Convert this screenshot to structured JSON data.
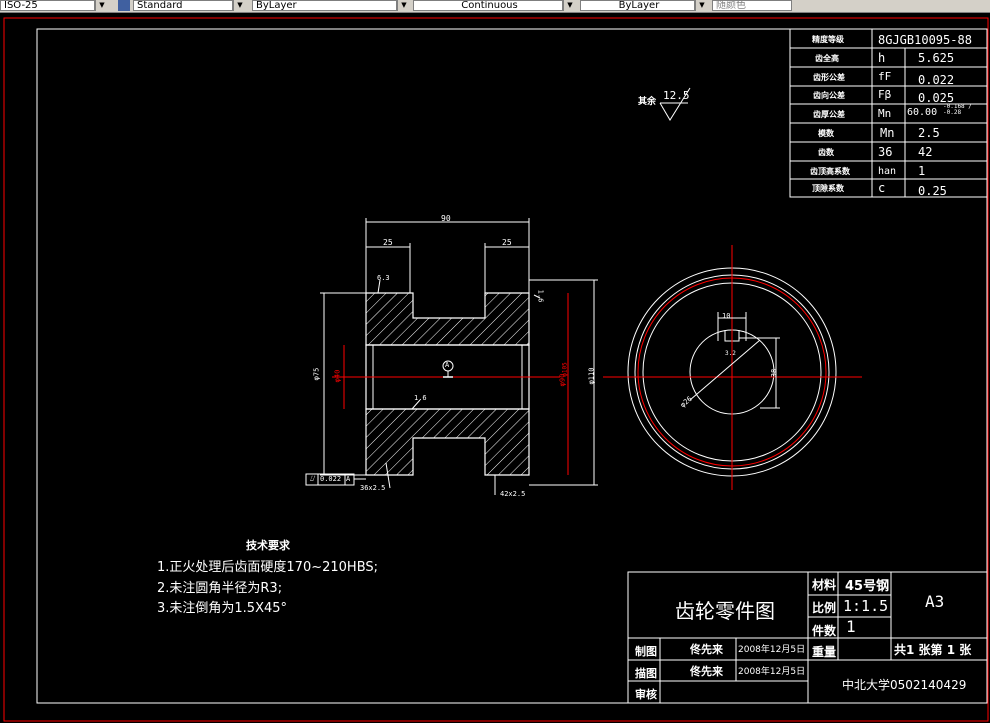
{
  "toolbar": {
    "text_style": "ISO-25",
    "dim_style": "Standard",
    "layer": "ByLayer",
    "linetype": "Continuous",
    "lineweight": "ByLayer",
    "plotstyle": "随颜色"
  },
  "colors": {
    "background": "#000000",
    "white": "#ffffff",
    "red": "#ff0000",
    "hatch": "#ffffff"
  },
  "params": {
    "rows": [
      {
        "label": "精度等级",
        "sym": "",
        "value": "8GJGB10095-88",
        "value2": ""
      },
      {
        "label": "齿全高",
        "sym": "h",
        "value": "5.625",
        "value2": ""
      },
      {
        "label": "齿形公差",
        "sym": "fF",
        "value": "0.022",
        "value2": ""
      },
      {
        "label": "齿向公差",
        "sym": "Fβ",
        "value": "0.025",
        "value2": ""
      },
      {
        "label": "齿厚公差",
        "sym": "Mn",
        "value": "60.00",
        "value2": "-0.168 / -0.28"
      },
      {
        "label": "模数",
        "sym": "Mn",
        "value": "2.5",
        "value2": ""
      },
      {
        "label": "齿数",
        "sym": "36",
        "value": "42",
        "value2": ""
      },
      {
        "label": "齿顶高系数",
        "sym": "han",
        "value": "1",
        "value2": ""
      },
      {
        "label": "顶隙系数",
        "sym": "c",
        "value": "0.25",
        "value2": ""
      }
    ]
  },
  "roughness": {
    "label": "其余",
    "value": "12.5"
  },
  "dimensions": {
    "overall_width": "90",
    "left_hub": "25",
    "right_hub": "25",
    "hub_dia": "φ75",
    "bore_dia": "φ40",
    "pitch_dia_a": "φ90",
    "pitch_dia_b": "φ105",
    "outer_dia": "φ110",
    "chamfer_a": "6.3",
    "chamfer_b": "1.6",
    "chamfer_c": "1.6",
    "datum": "A",
    "tolerance": "0.022",
    "tolerance_ref": "A",
    "gear_a": "36x2.5",
    "gear_b": "42x2.5",
    "key_width": "10",
    "key_depth": "38",
    "key_finish": "3.2",
    "bore_label": "φ26"
  },
  "notes": {
    "title": "技术要求",
    "lines": [
      "1.正火处理后齿面硬度170~210HBS;",
      "2.未注圆角半径为R3;",
      "3.未注倒角为1.5X45°"
    ]
  },
  "titleblock": {
    "drawing_name": "齿轮零件图",
    "material_label": "材料",
    "material": "45号钢",
    "scale_label": "比例",
    "scale": "1:1.5",
    "qty_label": "件数",
    "qty": "1",
    "sheet": "A3",
    "weight_label": "重量",
    "sheet_info": "共1 张第 1 张",
    "drawn_label": "制图",
    "drawn_by": "佟先来",
    "drawn_date": "2008年12月5日",
    "traced_label": "描图",
    "traced_by": "佟先来",
    "traced_date": "2008年12月5日",
    "checked_label": "审核",
    "school": "中北大学0502140429"
  }
}
